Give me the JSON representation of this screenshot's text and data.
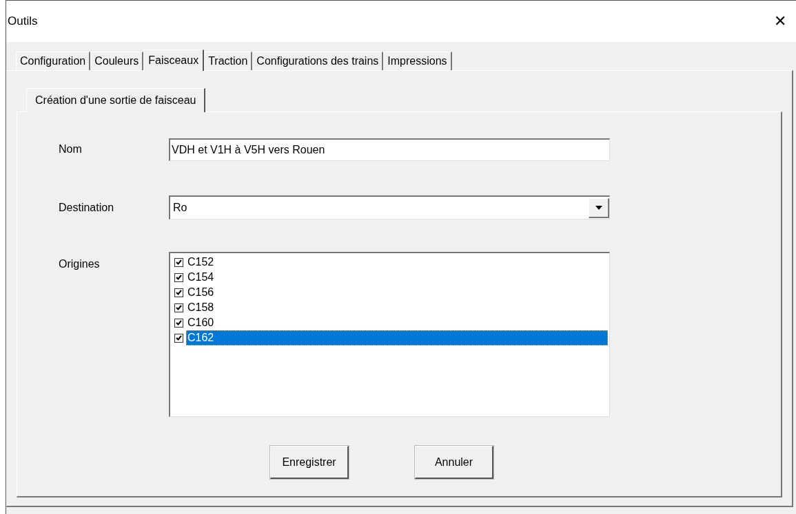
{
  "window": {
    "title": "Outils",
    "close": "✕"
  },
  "tabs": [
    {
      "label": "Configuration",
      "selected": false
    },
    {
      "label": "Couleurs",
      "selected": false
    },
    {
      "label": "Faisceaux",
      "selected": true
    },
    {
      "label": "Traction",
      "selected": false
    },
    {
      "label": "Configurations des trains",
      "selected": false
    },
    {
      "label": "Impressions",
      "selected": false
    }
  ],
  "subtabs": [
    {
      "label": "Création d'une sortie de faisceau",
      "selected": true
    }
  ],
  "form": {
    "nom": {
      "label": "Nom",
      "value": "VDH et V1H à V5H vers Rouen"
    },
    "destination": {
      "label": "Destination",
      "value": "Ro"
    },
    "origines": {
      "label": "Origines",
      "items": [
        {
          "label": "C152",
          "checked": true,
          "selected": false
        },
        {
          "label": "C154",
          "checked": true,
          "selected": false
        },
        {
          "label": "C156",
          "checked": true,
          "selected": false
        },
        {
          "label": "C158",
          "checked": true,
          "selected": false
        },
        {
          "label": "C160",
          "checked": true,
          "selected": false
        },
        {
          "label": "C162",
          "checked": true,
          "selected": true
        }
      ]
    }
  },
  "buttons": [
    {
      "label": "Enregistrer"
    },
    {
      "label": "Annuler"
    }
  ]
}
